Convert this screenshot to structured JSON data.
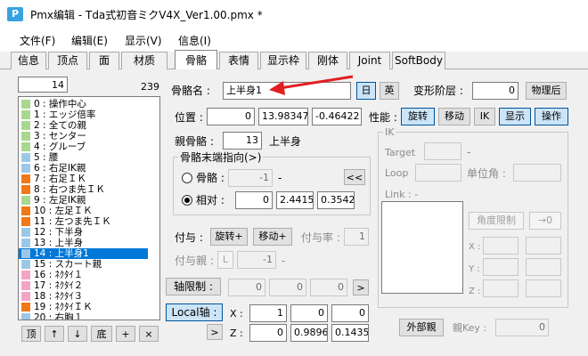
{
  "window": {
    "app": "Pmx编辑",
    "title": "Pmx编辑 - Tda式初音ミクV4X_Ver1.00.pmx *",
    "icon": "app-icon"
  },
  "menu": [
    "文件(F)",
    "编辑(E)",
    "显示(V)",
    "信息(I)"
  ],
  "tabs": [
    "信息",
    "顶点",
    "面",
    "材质",
    "骨骼",
    "表情",
    "显示枠",
    "刚体",
    "Joint",
    "SoftBody"
  ],
  "active_tab": "骨骼",
  "list": {
    "search_value": "14",
    "count": "239",
    "items": [
      {
        "label": "0 : 操作中心",
        "color": "#a8d890"
      },
      {
        "label": "1 : エッジ倍率",
        "color": "#a8d890"
      },
      {
        "label": "2 : 全ての親",
        "color": "#a8d890"
      },
      {
        "label": "3 : センター",
        "color": "#a8d890"
      },
      {
        "label": "4 : グルーブ",
        "color": "#a8d890"
      },
      {
        "label": "5 : 腰",
        "color": "#9cc8e8"
      },
      {
        "label": "6 : 右足IK親",
        "color": "#9cc8e8"
      },
      {
        "label": "7 : 右足ＩＫ",
        "color": "#f07818"
      },
      {
        "label": "8 : 右つま先ＩＫ",
        "color": "#f07818"
      },
      {
        "label": "9 : 左足IK親",
        "color": "#a8d890"
      },
      {
        "label": "10 : 左足ＩＫ",
        "color": "#f07818"
      },
      {
        "label": "11 : 左つま先ＩＫ",
        "color": "#f07818"
      },
      {
        "label": "12 : 下半身",
        "color": "#9cc8e8"
      },
      {
        "label": "13 : 上半身",
        "color": "#9cc8e8"
      },
      {
        "label": "14 : 上半身1",
        "color": "#9cc8e8"
      },
      {
        "label": "15 : スカート親",
        "color": "#9cc8e8"
      },
      {
        "label": "16 : ﾈｸﾀｲ１",
        "color": "#f4a4c4"
      },
      {
        "label": "17 : ﾈｸﾀｲ２",
        "color": "#f4a4c4"
      },
      {
        "label": "18 : ﾈｸﾀｲ３",
        "color": "#f4a4c4"
      },
      {
        "label": "19 : ﾈｸﾀｲＩＫ",
        "color": "#f07818"
      },
      {
        "label": "20 : 右胸１",
        "color": "#9cc8e8"
      }
    ],
    "selected_index": 14,
    "nav": [
      "顶",
      "↑",
      "↓",
      "底",
      "+",
      "×"
    ]
  },
  "bone": {
    "name_label": "骨骼名 :",
    "name_value": "上半身1",
    "lang_jp": "日",
    "lang_en": "英",
    "deform_label": "变形阶层 :",
    "deform_value": "0",
    "after_physics": "物理后",
    "pos_label": "位置 :",
    "pos": [
      "0",
      "13.98347",
      "-0.46422"
    ],
    "perf_label": "性能 :",
    "perf_buttons": [
      "旋转",
      "移动",
      "IK",
      "显示",
      "操作"
    ],
    "parent_label": "親骨骼 :",
    "parent_value": "13",
    "parent_name": "上半身",
    "tail_group": "骨骼末端指向(>)",
    "tail_bone_label": "骨骼 :",
    "tail_bone_value": "-1",
    "tail_bone_dash": "-",
    "tail_go": "<<",
    "tail_rel_label": "相对 :",
    "tail_rel": [
      "0",
      "2.4415",
      "0.3542"
    ],
    "grant_label": "付与 :",
    "grant_rot": "旋转+",
    "grant_move": "移动+",
    "grant_rate_label": "付与率 :",
    "grant_rate": "1",
    "grant_parent_label": "付与親 :",
    "grant_parent_btn": "L",
    "grant_parent_value": "-1",
    "grant_parent_dash": "-",
    "axis_limit": "轴限制 :",
    "axis": [
      "0",
      "0",
      "0"
    ],
    "axis_go": ">",
    "local_axis": "Local轴 :",
    "local_x_label": "X :",
    "local_x": [
      "1",
      "0",
      "0"
    ],
    "local_z_label": "Z :",
    "local_z": [
      "0",
      "0.9896",
      "0.1435"
    ],
    "local_go": ">",
    "ik_group": "IK",
    "ik_target_label": "Target",
    "ik_target_dash": "-",
    "ik_loop_label": "Loop",
    "ik_unit_label": "单位角 :",
    "ik_link_label": "Link : -",
    "ik_angle_limit": "角度限制",
    "ik_zero": "→0",
    "ik_x": "X :",
    "ik_y": "Y :",
    "ik_z": "Z :",
    "external_parent": "外部親",
    "parent_key_label": "親Key :",
    "parent_key": "0"
  },
  "colors": {
    "accent": "#0078d7",
    "arrow": "#e02020"
  }
}
